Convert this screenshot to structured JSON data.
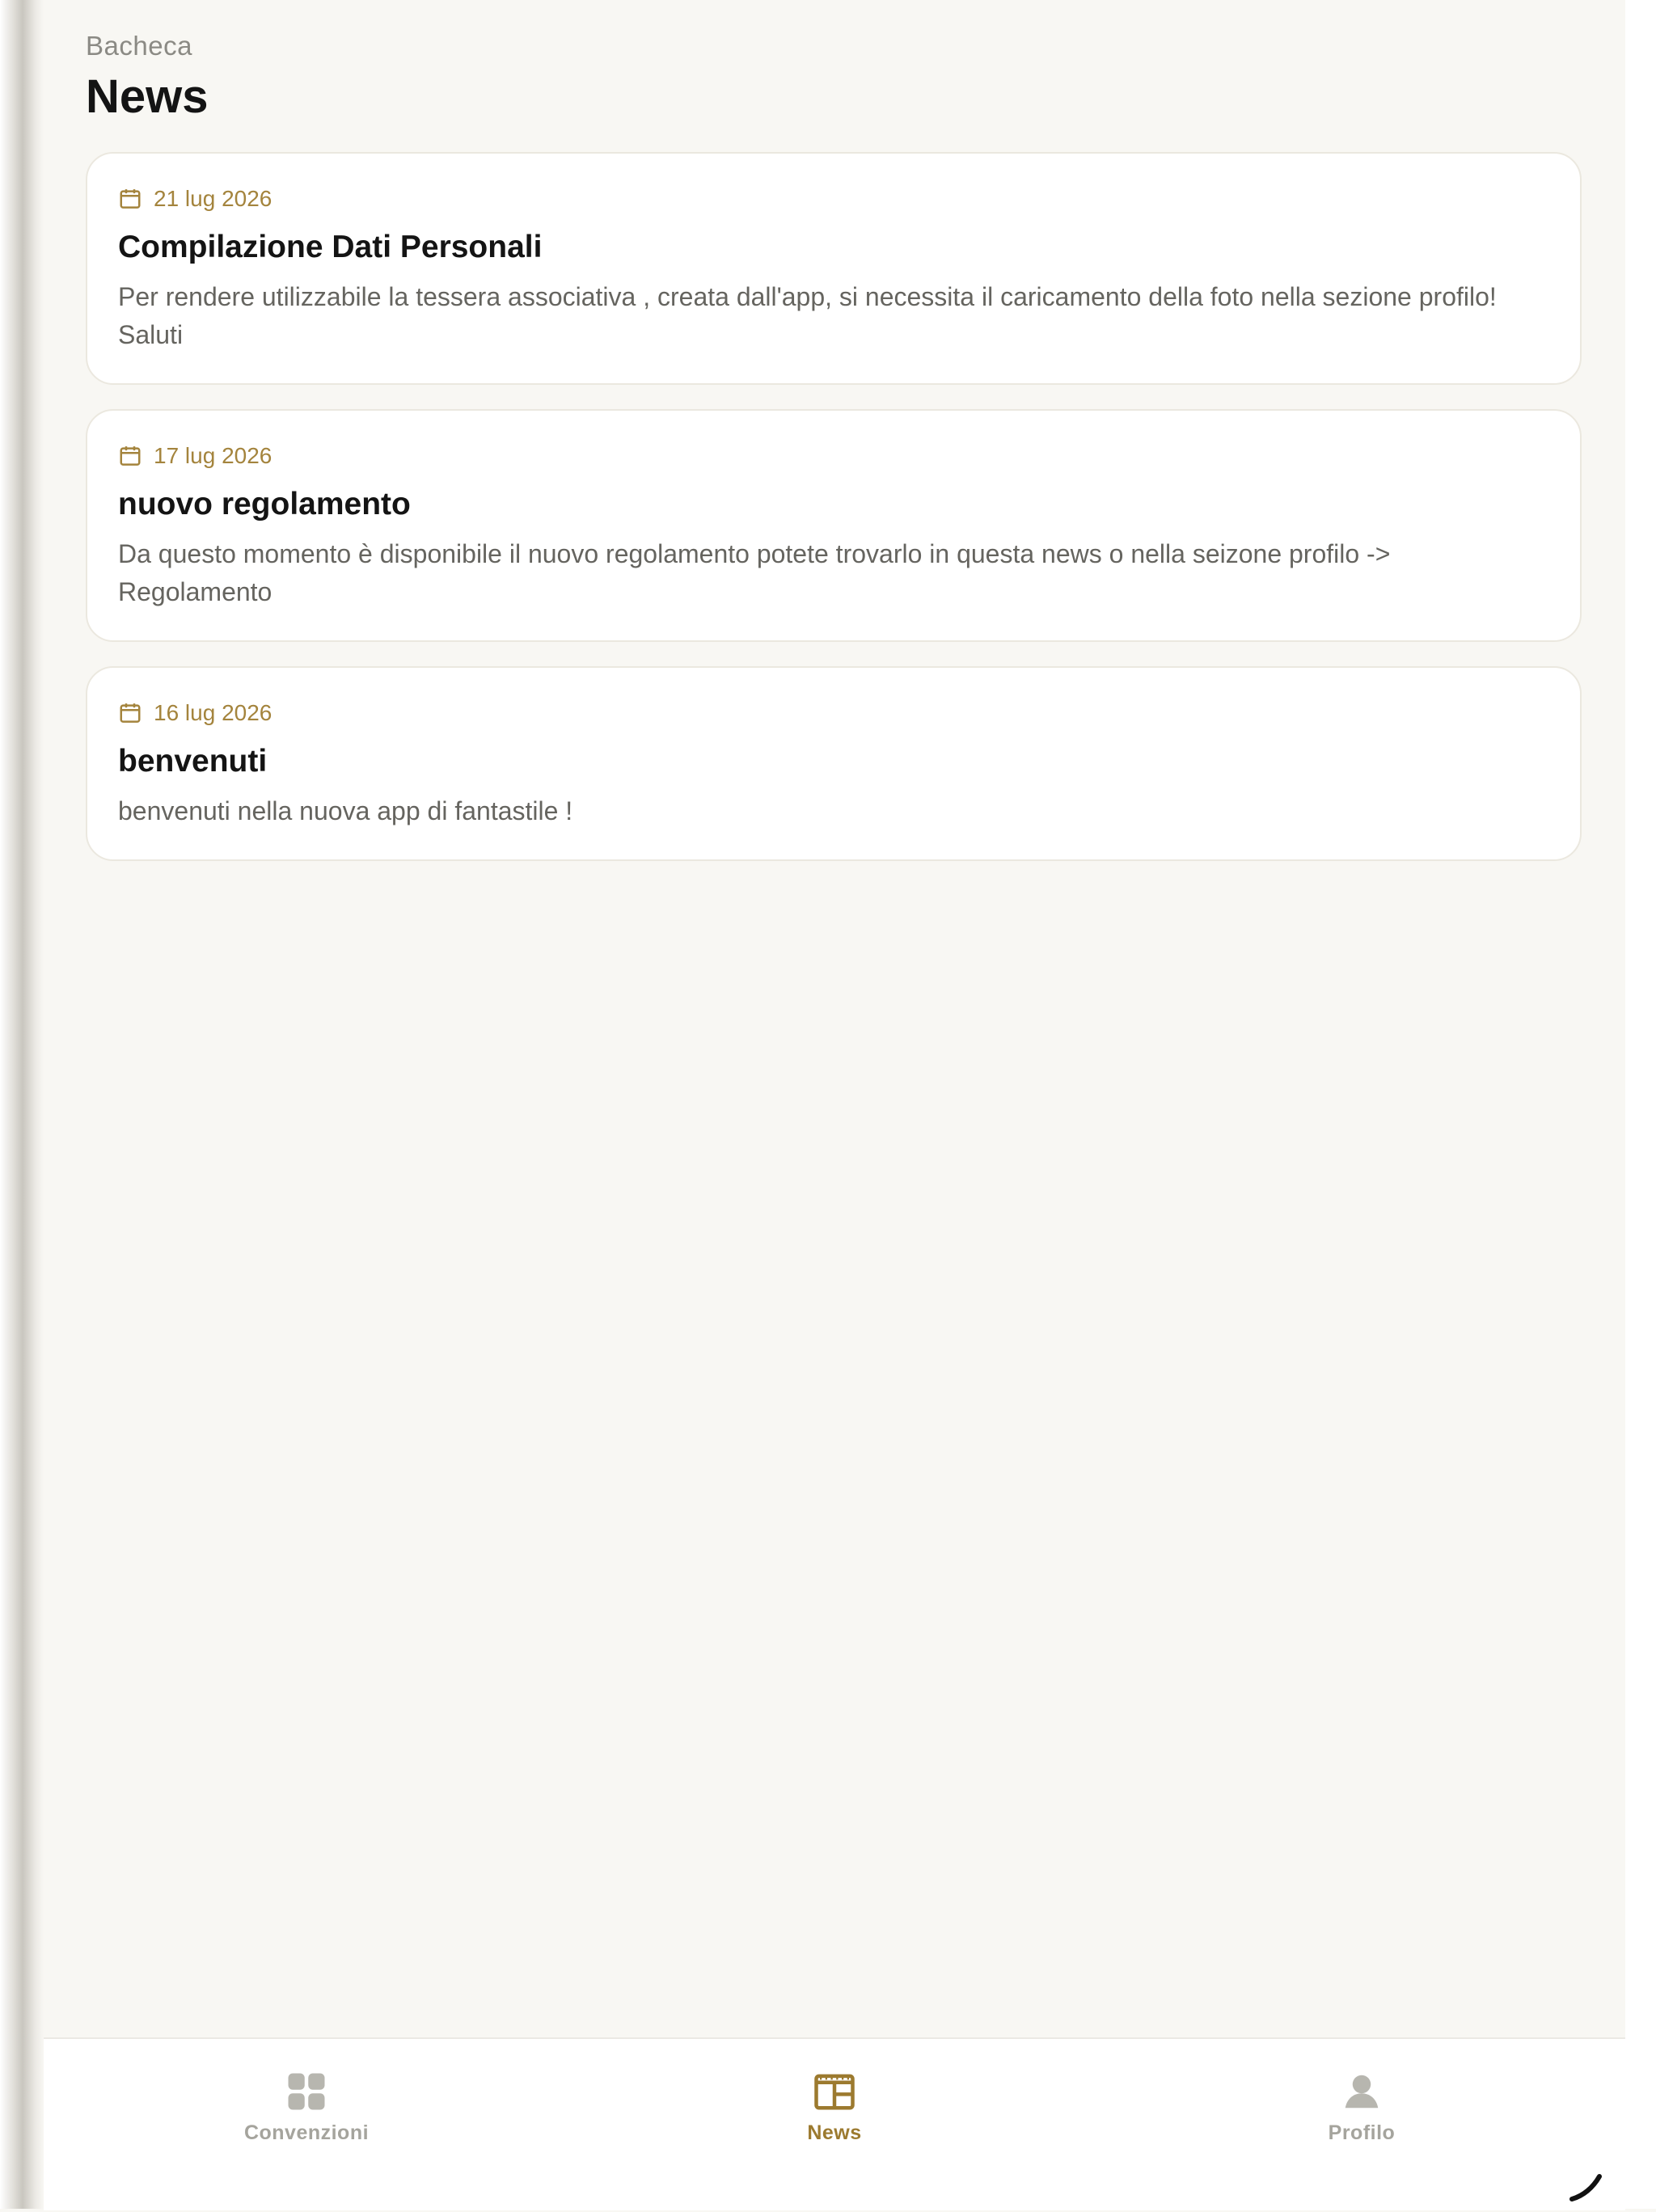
{
  "header": {
    "eyebrow": "Bacheca",
    "title": "News"
  },
  "news": [
    {
      "date": "21 lug 2026",
      "title": "Compilazione Dati Personali",
      "body": "Per rendere utilizzabile la tessera associativa , creata dall'app, si necessita il caricamento della foto nella sezione profilo! Saluti"
    },
    {
      "date": "17 lug 2026",
      "title": "nuovo regolamento",
      "body": "Da questo momento è disponibile il nuovo regolamento potete trovarlo in questa news o nella seizone profilo -> Regolamento"
    },
    {
      "date": "16 lug 2026",
      "title": "benvenuti",
      "body": "benvenuti nella nuova app di fantastile !"
    }
  ],
  "nav": {
    "items": [
      {
        "label": "Convenzioni",
        "icon": "grid-icon",
        "active": false
      },
      {
        "label": "News",
        "icon": "newspaper-icon",
        "active": true
      },
      {
        "label": "Profilo",
        "icon": "user-icon",
        "active": false
      }
    ]
  },
  "colors": {
    "accent": "#a4843d",
    "background": "#f8f7f3",
    "card": "#ffffff",
    "text": "#141414",
    "muted": "#65645f"
  }
}
